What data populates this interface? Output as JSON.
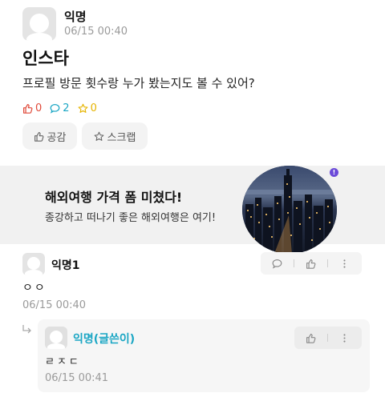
{
  "post": {
    "author": "익명",
    "time": "06/15 00:40",
    "title": "인스타",
    "body": "프로필 방문 횟수랑 누가 봤는지도 볼 수 있어?",
    "stats": {
      "likes": "0",
      "comments": "2",
      "scraps": "0"
    },
    "like_button_label": "공감",
    "scrap_button_label": "스크랩"
  },
  "ad": {
    "title": "해외여행 가격 폼 미쳤다!",
    "subtitle": "종강하고 떠나기 좋은 해외여행은 여기!",
    "badge": "!"
  },
  "comments": [
    {
      "author": "익명1",
      "body": "ㅇㅇ",
      "time": "06/15 00:40"
    }
  ],
  "replies": [
    {
      "author": "익명(글쓴이)",
      "body": "ㄹㅈㄷ",
      "time": "06/15 00:41"
    }
  ],
  "colors": {
    "like": "#e04a3a",
    "comment": "#1aa6c4",
    "scrap": "#e6b400",
    "author_highlight": "#1aa6c4"
  },
  "icons": [
    "thumbs-up-icon",
    "speech-bubble-icon",
    "star-icon",
    "more-vertical-icon",
    "reply-arrow-icon"
  ]
}
